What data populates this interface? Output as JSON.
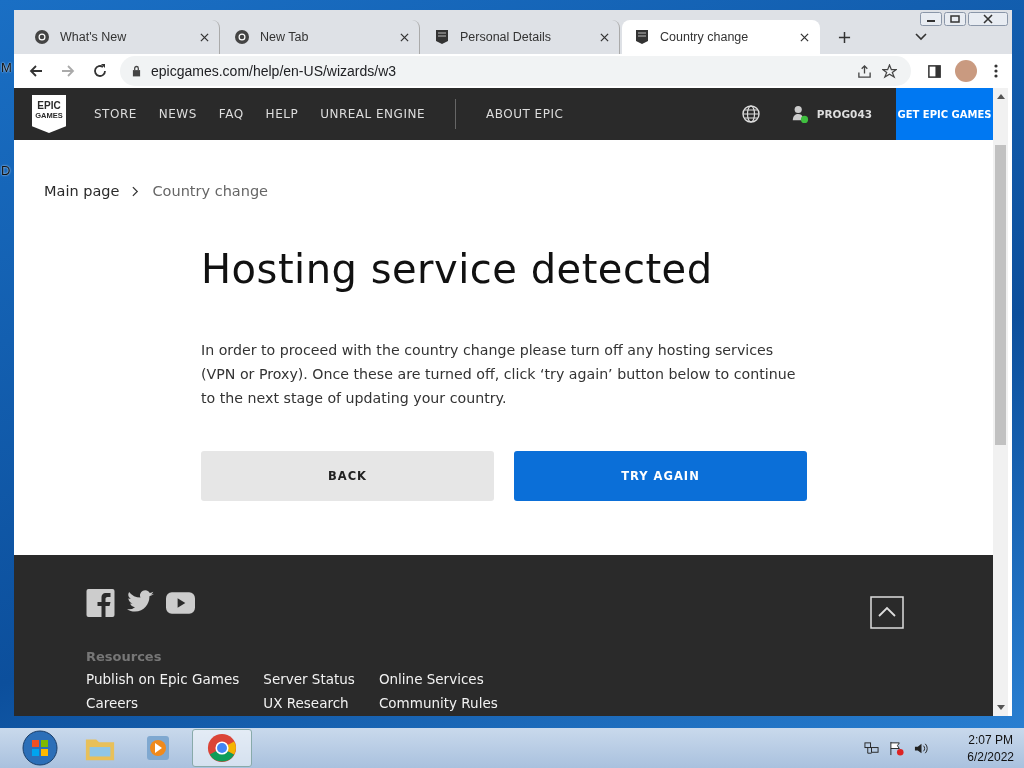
{
  "desktop_labels": [
    "M",
    "D"
  ],
  "browser": {
    "tabs": [
      {
        "title": "What's New",
        "kind": "chrome",
        "selected": false
      },
      {
        "title": "New Tab",
        "kind": "chrome",
        "selected": false
      },
      {
        "title": "Personal Details",
        "kind": "epic",
        "selected": false
      },
      {
        "title": "Country change",
        "kind": "epic",
        "selected": true
      }
    ],
    "url": "epicgames.com/help/en-US/wizards/w3"
  },
  "site_nav": {
    "logo_lines": [
      "EPIC",
      "GAMES"
    ],
    "items": [
      "STORE",
      "NEWS",
      "FAQ",
      "HELP",
      "UNREAL ENGINE"
    ],
    "secondary_items": [
      "ABOUT EPIC"
    ],
    "username": "PROG043",
    "online": true,
    "cta": "GET EPIC GAMES"
  },
  "breadcrumb": [
    "Main page",
    "Country change"
  ],
  "heading": "Hosting service detected",
  "body": "In order to proceed with the country change please turn off any hosting services (VPN or Proxy). Once these are turned off, click ‘try again’ button below to continue to the next stage of updating your country.",
  "buttons": [
    {
      "label": "BACK",
      "kind": "secondary"
    },
    {
      "label": "TRY AGAIN",
      "kind": "primary"
    }
  ],
  "footer": {
    "section_title": "Resources",
    "links": [
      [
        "Publish on Epic Games",
        "Careers"
      ],
      [
        "Server Status",
        "UX Research"
      ],
      [
        "Online Services",
        "Community Rules"
      ]
    ]
  },
  "taskbar": {
    "time": "2:07 PM",
    "date": "6/2/2022"
  }
}
